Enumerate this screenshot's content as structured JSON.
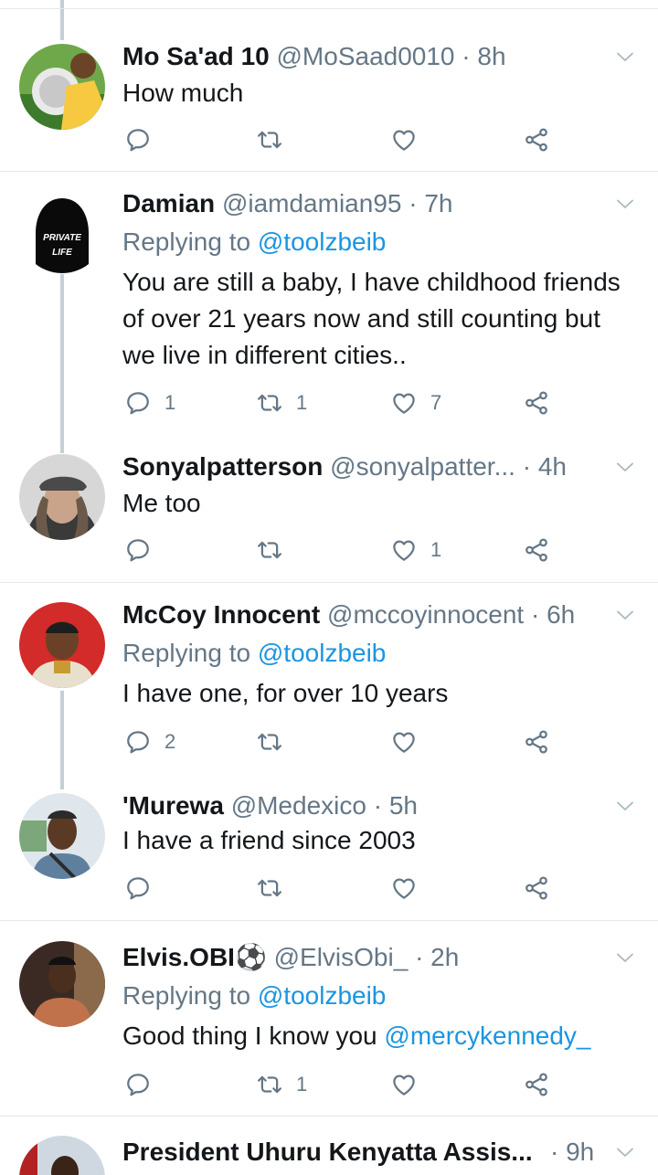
{
  "tweets": [
    {
      "name": "Mo Sa'ad 10",
      "handle": "@MoSaad0010",
      "time": "8h",
      "replying": null,
      "body": "How much",
      "body_mention": "",
      "counts": {
        "reply": "",
        "retweet": "",
        "like": ""
      }
    },
    {
      "name": "Damian",
      "handle": "@iamdamian95",
      "time": "7h",
      "replying": {
        "prefix": "Replying to",
        "user": "@toolzbeib"
      },
      "body": "You are still a baby, I have childhood friends of over 21 years now and still counting but we live in different cities..",
      "body_mention": "",
      "avatar_text": [
        "PRIVATE",
        "LIFE"
      ],
      "counts": {
        "reply": "1",
        "retweet": "1",
        "like": "7"
      }
    },
    {
      "name": "Sonyalpatterson",
      "handle": "@sonyalpatter...",
      "time": "4h",
      "replying": null,
      "body": "Me too",
      "body_mention": "",
      "counts": {
        "reply": "",
        "retweet": "",
        "like": "1"
      }
    },
    {
      "name": "McCoy Innocent",
      "handle": "@mccoyinnocent",
      "time": "6h",
      "replying": {
        "prefix": "Replying to",
        "user": "@toolzbeib"
      },
      "body": "I have one, for over 10 years",
      "body_mention": "",
      "counts": {
        "reply": "2",
        "retweet": "",
        "like": ""
      }
    },
    {
      "name": "'Murewa",
      "handle": "@Medexico",
      "time": "5h",
      "replying": null,
      "body": "I have a friend since 2003",
      "body_mention": "",
      "counts": {
        "reply": "",
        "retweet": "",
        "like": ""
      }
    },
    {
      "name": "Elvis.OBI⚽",
      "handle": "@ElvisObi_",
      "time": "2h",
      "replying": {
        "prefix": "Replying to",
        "user": "@toolzbeib"
      },
      "body": "Good thing I know you",
      "body_mention": "@mercykennedy_",
      "counts": {
        "reply": "",
        "retweet": "1",
        "like": ""
      }
    },
    {
      "name": "President Uhuru Kenyatta Assis...",
      "handle": "",
      "time": "9h",
      "replying": null,
      "body": "",
      "body_mention": "",
      "counts": {
        "reply": "",
        "retweet": "",
        "like": ""
      }
    }
  ],
  "separator": "·",
  "colors": {
    "text": "#14171a",
    "secondary": "#657786",
    "link": "#1b95e0",
    "divider": "#e1e8ed",
    "thread_line": "#c4cfd6"
  },
  "icons": [
    "reply-icon",
    "retweet-icon",
    "like-icon",
    "share-icon",
    "chevron-down-icon"
  ]
}
